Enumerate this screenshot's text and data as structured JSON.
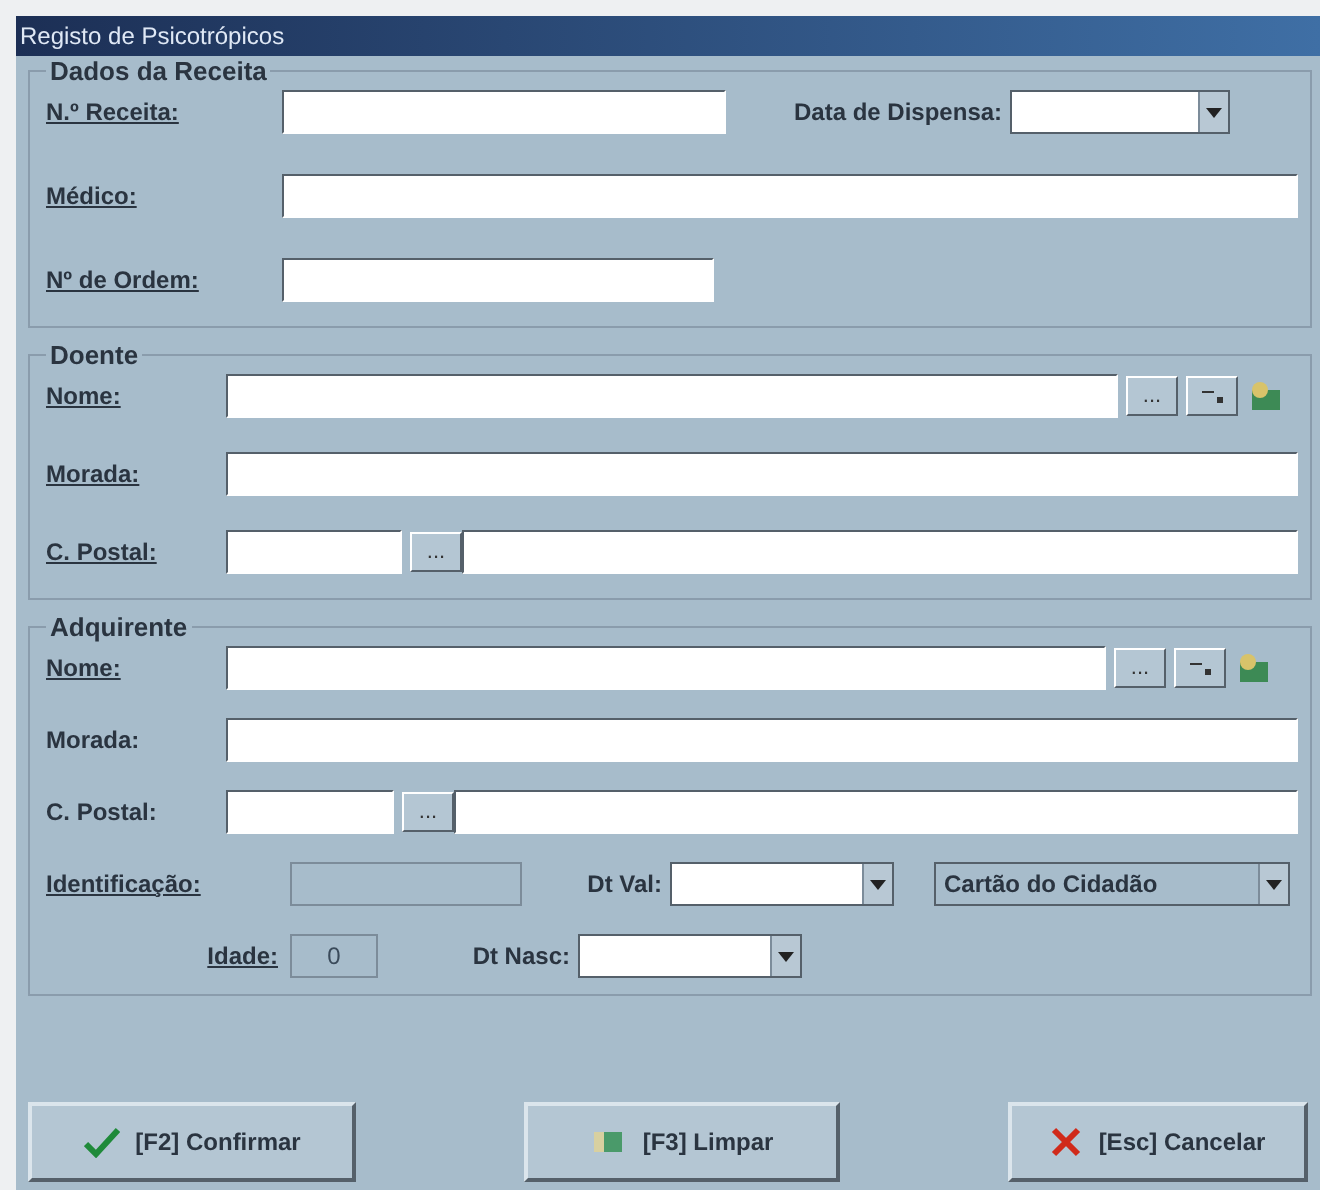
{
  "window": {
    "title": "Registo de Psicotrópicos"
  },
  "prescription": {
    "legend": "Dados da Receita",
    "number": {
      "label": "N.º Receita:",
      "required": true
    },
    "dispense_date": {
      "label": "Data de Dispensa:",
      "required": false
    },
    "doctor": {
      "label": "Médico:",
      "required": true
    },
    "order_number": {
      "label": "Nº de Ordem:",
      "required": true
    }
  },
  "patient": {
    "legend": "Doente",
    "name": {
      "label": "Nome:",
      "required": true
    },
    "name_lookup_button": "...",
    "address": {
      "label": "Morada:",
      "required": true
    },
    "postal_code": {
      "label": "C. Postal:",
      "required": true
    },
    "postal_lookup_button": "..."
  },
  "buyer": {
    "legend": "Adquirente",
    "name": {
      "label": "Nome:",
      "required": true
    },
    "name_lookup_button": "...",
    "address": {
      "label": "Morada:",
      "required": false
    },
    "postal_code": {
      "label": "C. Postal:",
      "required": false
    },
    "postal_lookup_button": "...",
    "identification": {
      "label": "Identificação:",
      "required": true
    },
    "valid_date": {
      "label": "Dt Val:",
      "required": false
    },
    "id_type": "Cartão do Cidadão",
    "age": {
      "label": "Idade:",
      "required": true
    },
    "age_value": "0",
    "birth_date": {
      "label": "Dt Nasc:",
      "required": false
    }
  },
  "buttons": [
    {
      "label": "[F2] Confirmar",
      "kind": "confirm"
    },
    {
      "label": "[F3] Limpar",
      "kind": "clear"
    },
    {
      "label": "[Esc] Cancelar",
      "kind": "cancel"
    }
  ]
}
